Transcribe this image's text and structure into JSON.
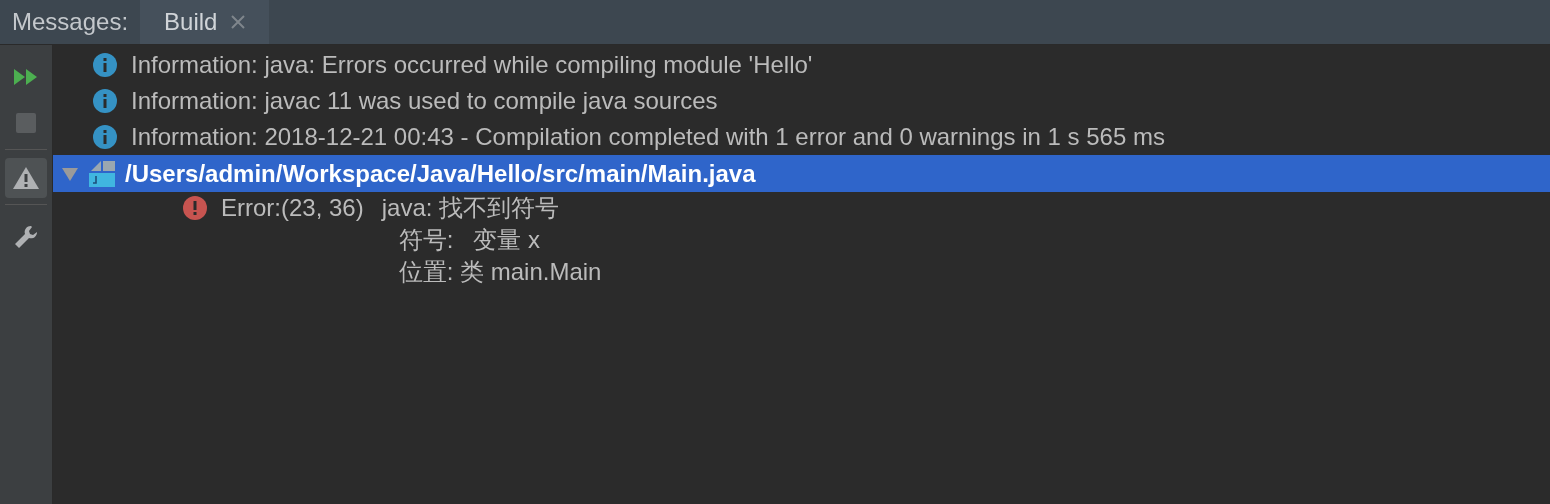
{
  "header": {
    "label": "Messages:"
  },
  "tabs": [
    {
      "label": "Build",
      "selected": true
    }
  ],
  "toolbar": [
    {
      "kind": "rerun",
      "disabled": false,
      "selected": false
    },
    {
      "kind": "stop",
      "disabled": true,
      "selected": false
    },
    {
      "kind": "warnings",
      "disabled": false,
      "selected": true
    },
    {
      "kind": "settings",
      "disabled": false,
      "selected": false
    }
  ],
  "messages": [
    {
      "kind": "info",
      "text": "Information: java: Errors occurred while compiling module 'Hello'"
    },
    {
      "kind": "info",
      "text": "Information: javac 11 was used to compile java sources"
    },
    {
      "kind": "info",
      "text": "Information: 2018-12-21 00:43 - Compilation completed with 1 error and 0 warnings in 1 s 565 ms"
    },
    {
      "kind": "file",
      "text": "/Users/admin/Workspace/Java/Hello/src/main/Main.java",
      "expanded": true,
      "selected": true,
      "children": [
        {
          "kind": "error",
          "location": "Error:(23, 36)",
          "lines": [
            "java: 找不到符号",
            "符号:   变量 x",
            "位置: 类 main.Main"
          ]
        }
      ]
    }
  ]
}
